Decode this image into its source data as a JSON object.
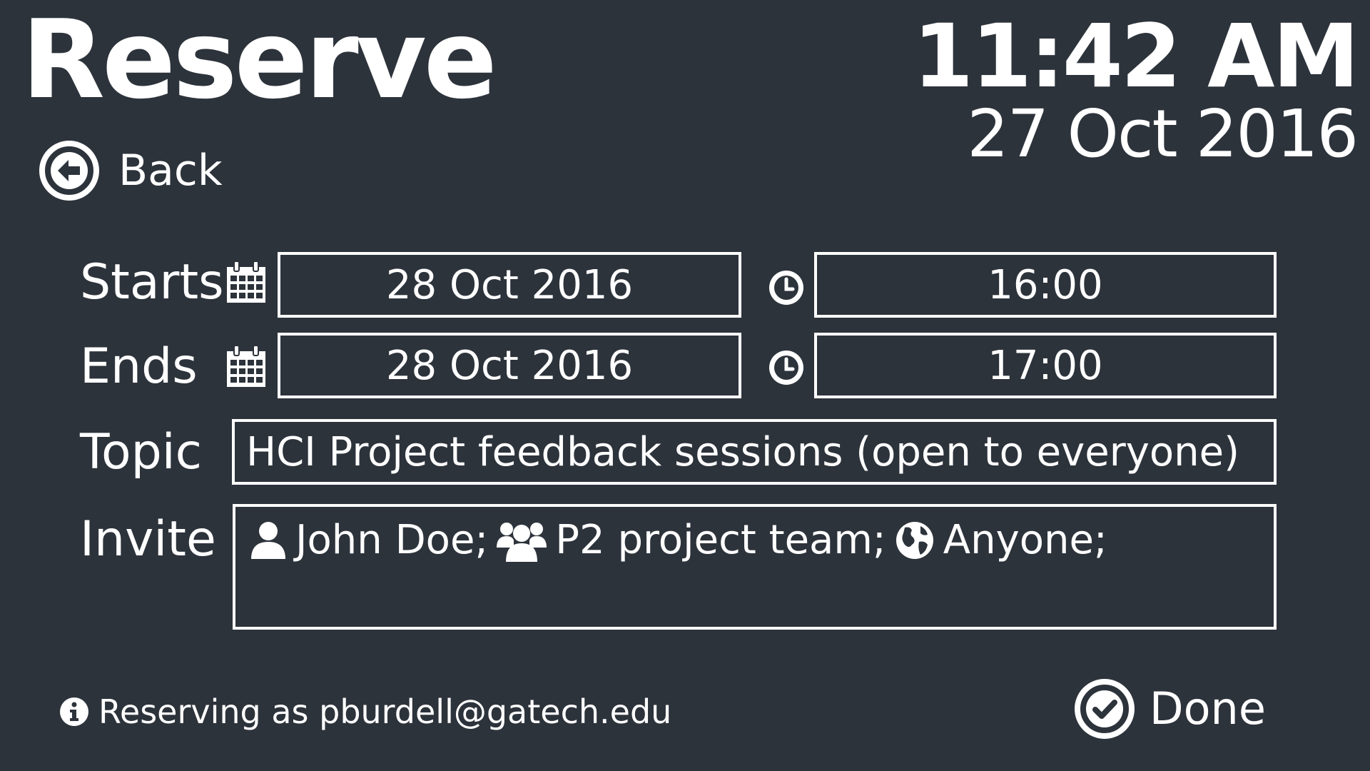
{
  "header": {
    "title": "Reserve",
    "time": "11:42 AM",
    "date": "27 Oct 2016",
    "back_label": "Back"
  },
  "form": {
    "starts": {
      "label": "Starts",
      "date": "28 Oct 2016",
      "time": "16:00"
    },
    "ends": {
      "label": "Ends",
      "date": "28 Oct 2016",
      "time": "17:00"
    },
    "topic": {
      "label": "Topic",
      "value": "HCI Project feedback sessions (open to everyone)"
    },
    "invite": {
      "label": "Invite",
      "items": [
        {
          "icon": "user-icon",
          "text": "John Doe;"
        },
        {
          "icon": "users-icon",
          "text": "P2 project team;"
        },
        {
          "icon": "globe-icon",
          "text": "Anyone;"
        }
      ]
    }
  },
  "footer": {
    "info": "Reserving as pburdell@gatech.edu",
    "done_label": "Done"
  },
  "colors": {
    "background": "#2d333b",
    "foreground": "#ffffff"
  }
}
